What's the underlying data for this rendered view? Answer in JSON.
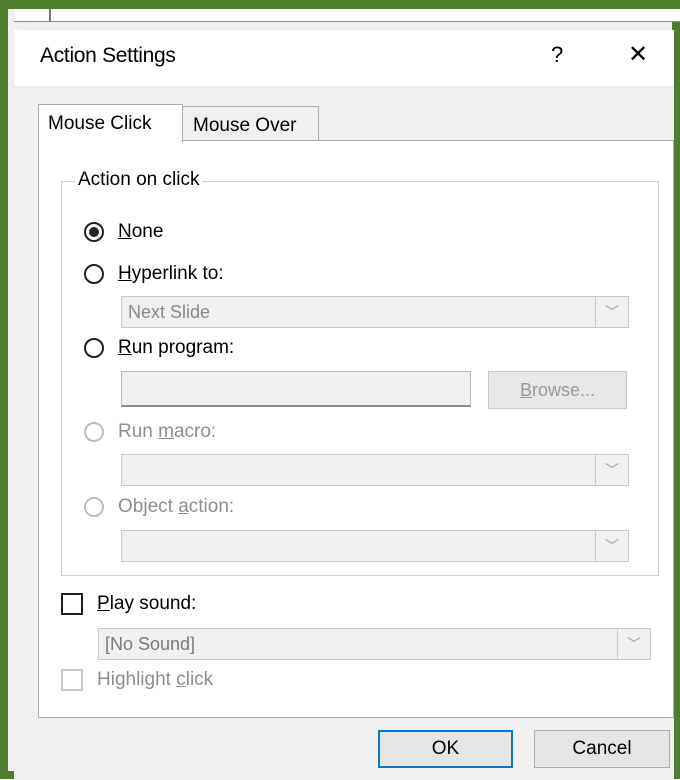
{
  "dialog": {
    "title": "Action Settings",
    "help": "?",
    "close": "✕"
  },
  "tabs": [
    {
      "label": "Mouse Click",
      "active": true
    },
    {
      "label": "Mouse Over",
      "active": false
    }
  ],
  "action_group": {
    "legend": "Action on click",
    "options": {
      "none": {
        "label_u": "N",
        "label_rest": "one",
        "checked": true,
        "enabled": true
      },
      "hyperlink": {
        "label_u": "H",
        "label_rest": "yperlink to:",
        "checked": false,
        "enabled": true,
        "combo_value": "Next Slide"
      },
      "run_program": {
        "label_u": "R",
        "label_rest": "un program:",
        "checked": false,
        "enabled": true,
        "input_value": "",
        "browse_label_u": "B",
        "browse_label_rest": "rowse..."
      },
      "run_macro": {
        "label_pre": "Run ",
        "label_u": "m",
        "label_rest": "acro:",
        "checked": false,
        "enabled": false,
        "combo_value": ""
      },
      "object_action": {
        "label_pre": "Object ",
        "label_u": "a",
        "label_rest": "ction:",
        "checked": false,
        "enabled": false,
        "combo_value": ""
      }
    }
  },
  "play_sound": {
    "label_u": "P",
    "label_rest": "lay sound:",
    "checked": false,
    "combo_value": "[No Sound]"
  },
  "highlight_click": {
    "label_pre": "Highlight ",
    "label_u": "c",
    "label_rest": "lick",
    "checked": false,
    "enabled": false
  },
  "buttons": {
    "ok": "OK",
    "cancel": "Cancel"
  },
  "colors": {
    "frame_border": "#4e7d2d",
    "ok_border": "#0078d7"
  },
  "icons": {
    "dropdown": "chevron-down-icon",
    "close": "close-icon",
    "help": "help-icon"
  }
}
